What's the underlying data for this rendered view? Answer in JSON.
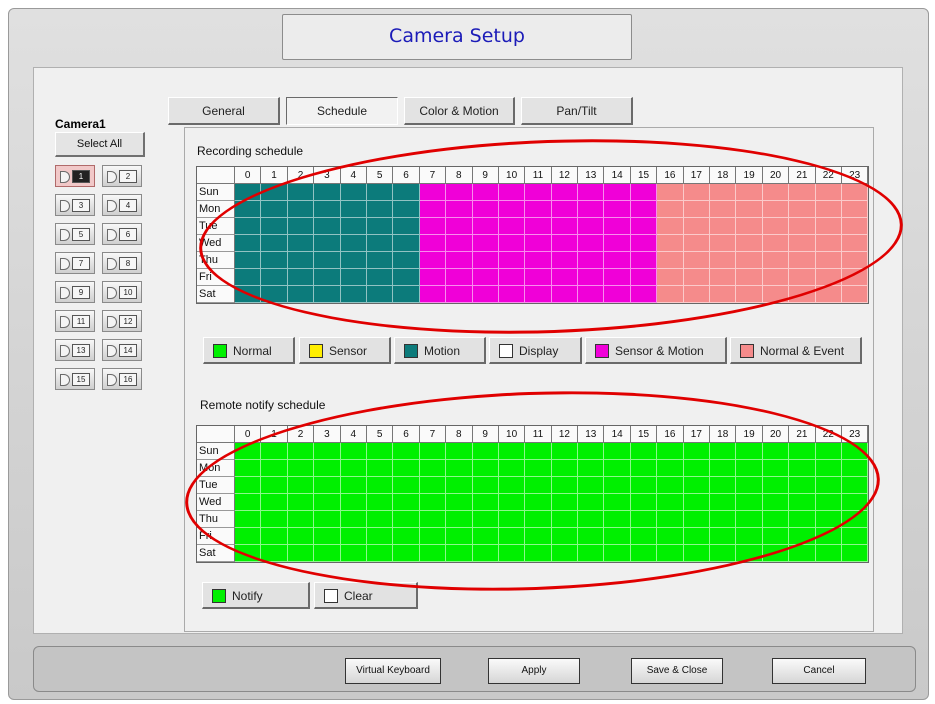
{
  "window": {
    "title": "Camera Setup"
  },
  "camera": {
    "name": "Camera1",
    "select_all_label": "Select All"
  },
  "camera_buttons": [
    "1",
    "2",
    "3",
    "4",
    "5",
    "6",
    "7",
    "8",
    "9",
    "10",
    "11",
    "12",
    "13",
    "14",
    "15",
    "16"
  ],
  "active_camera": 1,
  "tabs": [
    {
      "label": "General",
      "active": false
    },
    {
      "label": "Schedule",
      "active": true
    },
    {
      "label": "Color & Motion",
      "active": false
    },
    {
      "label": "Pan/Tilt",
      "active": false
    }
  ],
  "hours": [
    "0",
    "1",
    "2",
    "3",
    "4",
    "5",
    "6",
    "7",
    "8",
    "9",
    "10",
    "11",
    "12",
    "13",
    "14",
    "15",
    "16",
    "17",
    "18",
    "19",
    "20",
    "21",
    "22",
    "23"
  ],
  "days": [
    "Sun",
    "Mon",
    "Tue",
    "Wed",
    "Thu",
    "Fri",
    "Sat"
  ],
  "colors": {
    "normal": "#00f000",
    "sensor": "#ffee00",
    "motion": "#0c7b7b",
    "display": "#ffffff",
    "sensor_motion": "#f000d8",
    "normal_event": "#f58b8b"
  },
  "recording_schedule": {
    "label": "Recording schedule",
    "hour_modes": [
      "motion",
      "motion",
      "motion",
      "motion",
      "motion",
      "motion",
      "motion",
      "sensor_motion",
      "sensor_motion",
      "sensor_motion",
      "sensor_motion",
      "sensor_motion",
      "sensor_motion",
      "sensor_motion",
      "sensor_motion",
      "sensor_motion",
      "normal_event",
      "normal_event",
      "normal_event",
      "normal_event",
      "normal_event",
      "normal_event",
      "normal_event",
      "normal_event"
    ]
  },
  "legend": [
    {
      "label": "Normal",
      "mode": "normal"
    },
    {
      "label": "Sensor",
      "mode": "sensor"
    },
    {
      "label": "Motion",
      "mode": "motion"
    },
    {
      "label": "Display",
      "mode": "display"
    },
    {
      "label": "Sensor & Motion",
      "mode": "sensor_motion"
    },
    {
      "label": "Normal & Event",
      "mode": "normal_event"
    }
  ],
  "remote_notify_schedule": {
    "label": "Remote notify schedule",
    "fill": "notify"
  },
  "notify_legend": [
    {
      "label": "Notify",
      "color": "#00f000"
    },
    {
      "label": "Clear",
      "color": "#ffffff"
    }
  ],
  "footer": {
    "virtual_keyboard": "Virtual Keyboard",
    "apply": "Apply",
    "save_close": "Save & Close",
    "cancel": "Cancel"
  }
}
